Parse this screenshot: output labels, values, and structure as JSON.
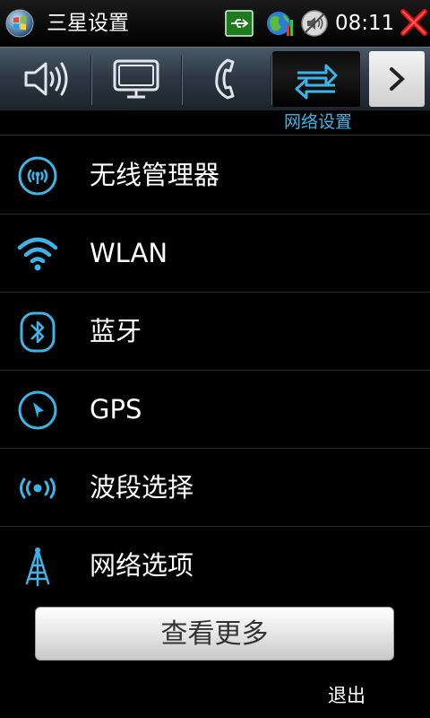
{
  "status_bar": {
    "title": "三星设置",
    "clock": "08:11"
  },
  "tabs": {
    "items": [
      {
        "icon": "speaker-icon"
      },
      {
        "icon": "monitor-icon"
      },
      {
        "icon": "phone-handset-icon"
      },
      {
        "icon": "network-arrows-icon",
        "selected": true,
        "label": "网络设置"
      },
      {
        "icon": "chevron-right-icon"
      }
    ],
    "selected_label": "网络设置"
  },
  "list": {
    "items": [
      {
        "label": "无线管理器",
        "icon": "wireless-manager-icon"
      },
      {
        "label": "WLAN",
        "icon": "wifi-icon"
      },
      {
        "label": "蓝牙",
        "icon": "bluetooth-icon"
      },
      {
        "label": "GPS",
        "icon": "gps-icon"
      },
      {
        "label": "波段选择",
        "icon": "band-signal-icon"
      },
      {
        "label": "网络选项",
        "icon": "antenna-icon"
      }
    ]
  },
  "buttons": {
    "more": "查看更多",
    "exit": "退出"
  },
  "colors": {
    "accent": "#3cb4e6",
    "background": "#000000"
  }
}
